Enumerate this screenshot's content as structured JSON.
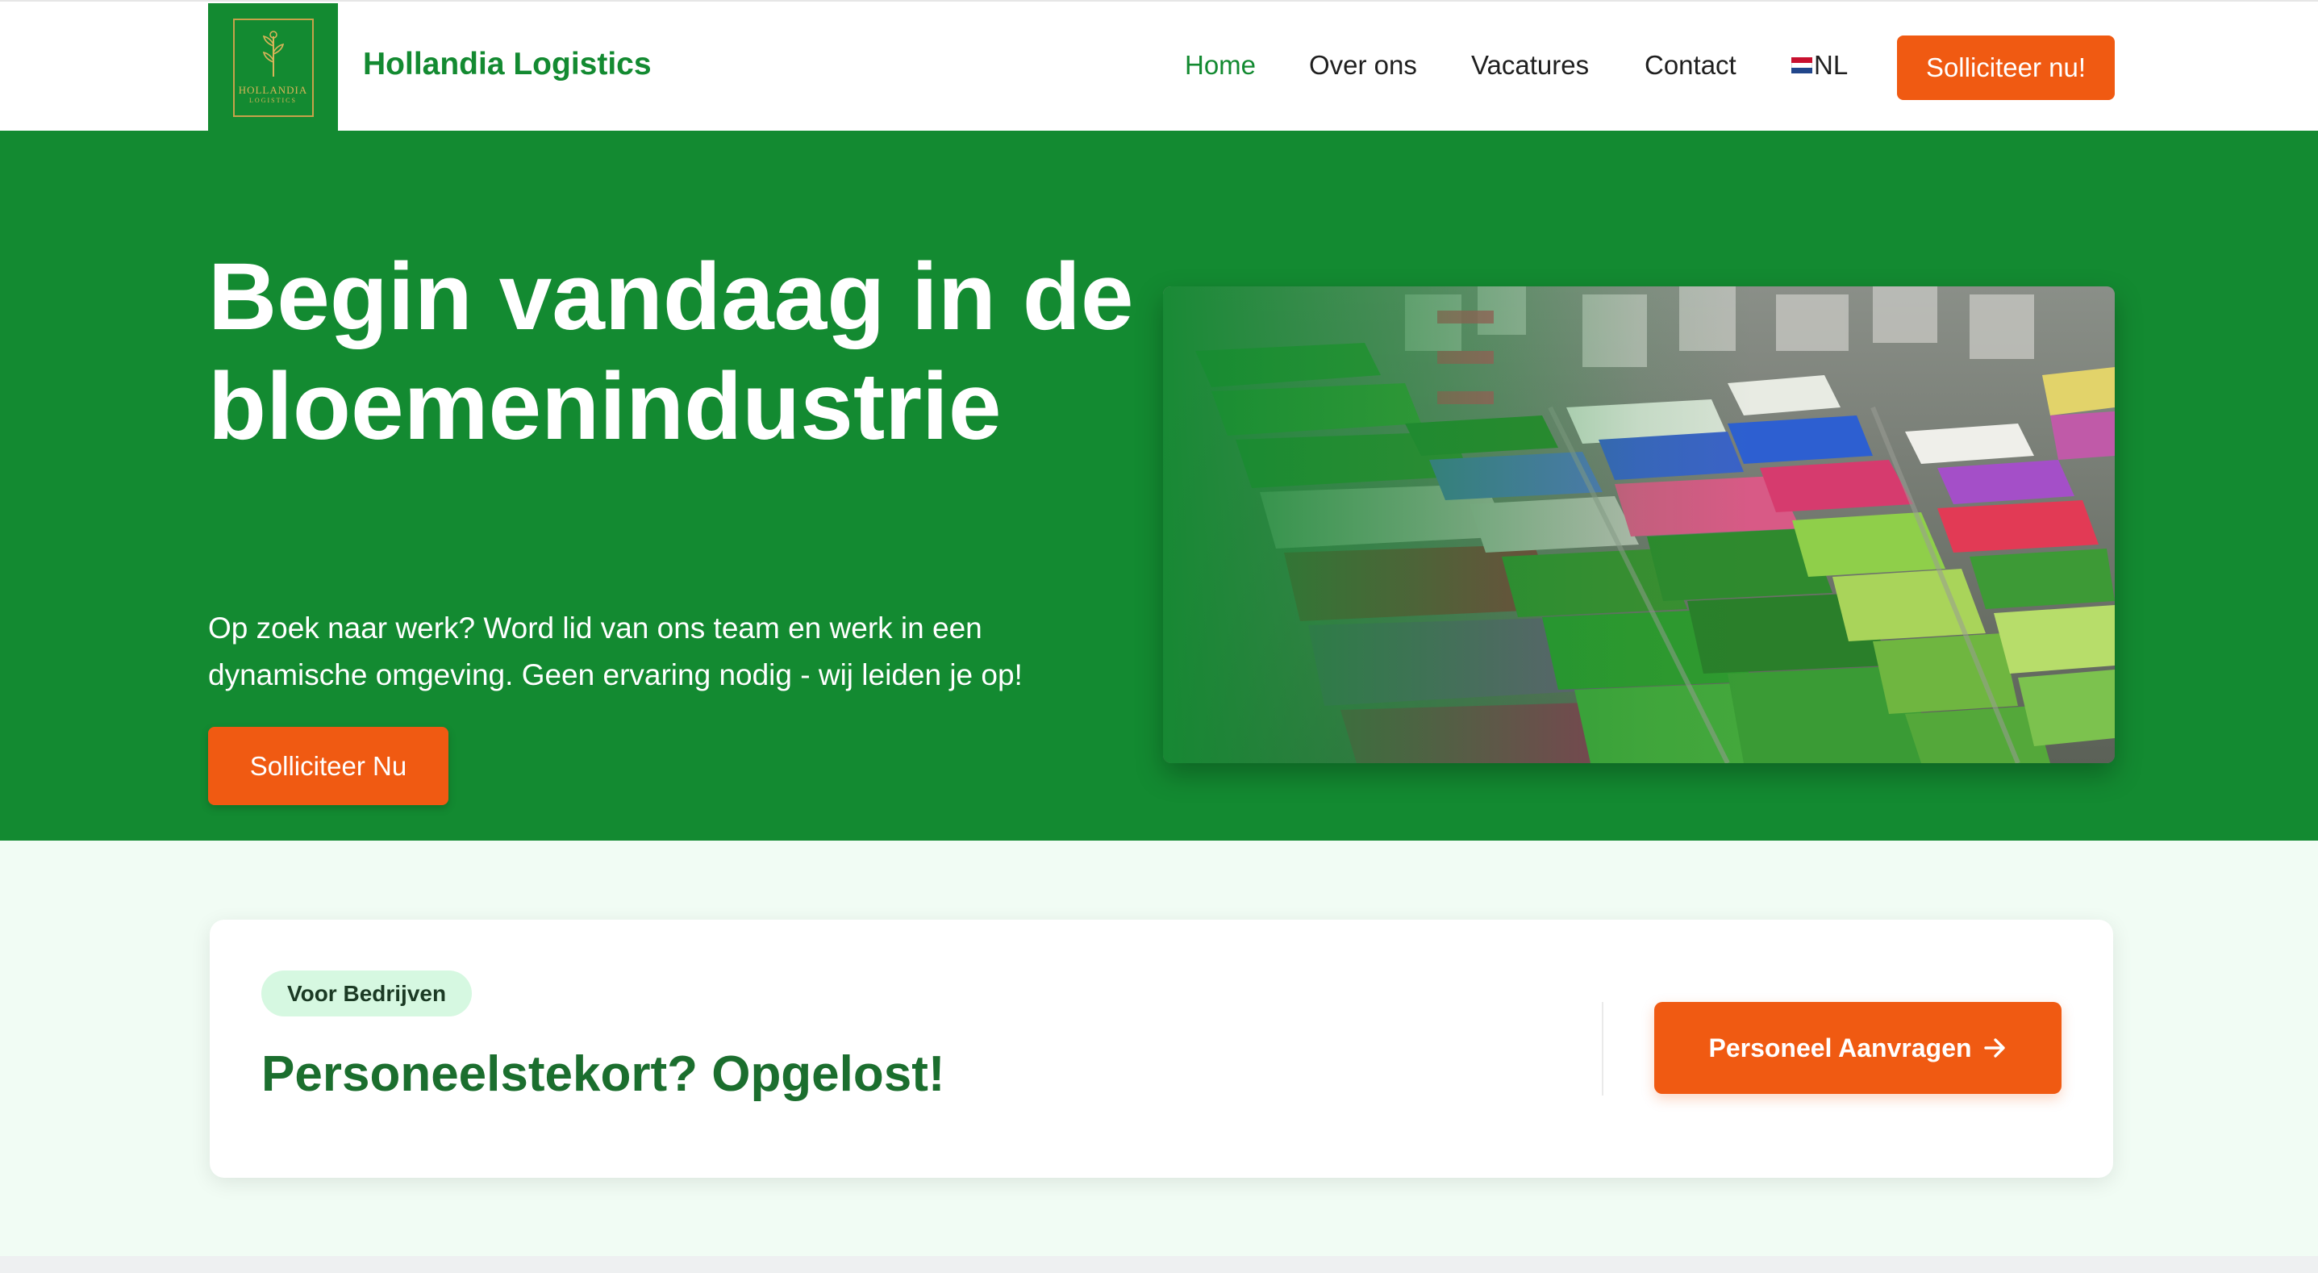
{
  "header": {
    "logo": {
      "word": "HOLLANDIA",
      "sub": "LOGISTICS"
    },
    "brand": "Hollandia Logistics",
    "nav": [
      {
        "label": "Home",
        "active": true
      },
      {
        "label": "Over ons",
        "active": false
      },
      {
        "label": "Vacatures",
        "active": false
      },
      {
        "label": "Contact",
        "active": false
      }
    ],
    "language": {
      "label": "NL",
      "icon": "dutch-flag-icon"
    },
    "cta": "Solliciteer nu!"
  },
  "hero": {
    "title": "Begin vandaag in de bloemenindustrie",
    "text": "Op zoek naar werk? Word lid van ons team en werk in een dynamische omgeving. Geen ervaring nodig - wij leiden je op!",
    "button": "Solliciteer Nu"
  },
  "business": {
    "badge": "Voor Bedrijven",
    "title": "Personeelstekort? Opgelost!",
    "button": "Personeel Aanvragen",
    "button_icon": "arrow-right-icon"
  },
  "colors": {
    "brand_green": "#138a31",
    "accent_orange": "#f05a12",
    "dark_green_text": "#1b6e2e",
    "badge_bg": "#d6f8e1",
    "section_bg": "#f1fcf4"
  }
}
